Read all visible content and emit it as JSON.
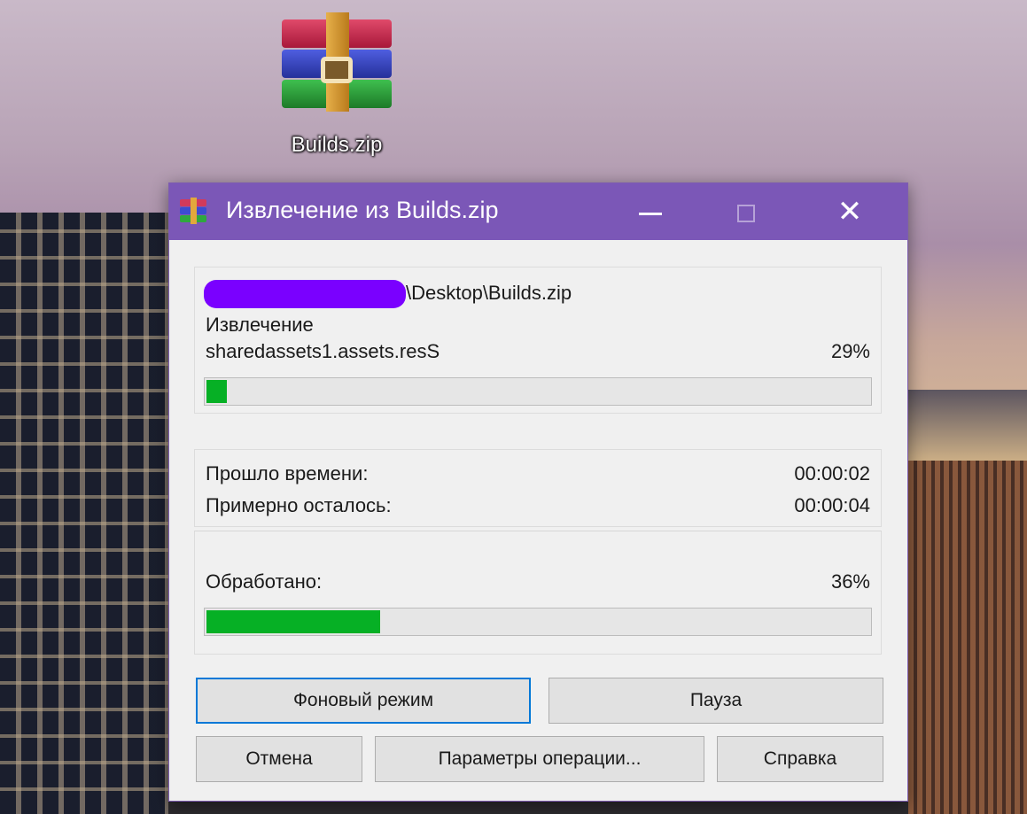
{
  "desktop": {
    "icon_label": "Builds.zip"
  },
  "dialog": {
    "title": "Извлечение из Builds.zip",
    "archive_path": "\\Desktop\\Builds.zip",
    "operation": "Извлечение",
    "current_file": "sharedassets1.assets.resS",
    "file_percent": "29%",
    "file_progress": 0.03,
    "elapsed_label": "Прошло времени:",
    "elapsed_value": "00:00:02",
    "remaining_label": "Примерно осталось:",
    "remaining_value": "00:00:04",
    "processed_label": "Обработано:",
    "processed_percent": "36%",
    "processed_progress": 0.26,
    "buttons": {
      "background": "Фоновый режим",
      "pause": "Пауза",
      "cancel": "Отмена",
      "params": "Параметры операции...",
      "help": "Справка"
    }
  },
  "colors": {
    "titlebar": "#7b57b7",
    "progress_fill": "#06b025",
    "redaction": "#7a00ff",
    "focus_border": "#0078d7"
  },
  "icons": [
    "winrar-archive-icon",
    "winrar-title-icon",
    "minimize-icon",
    "maximize-icon",
    "close-icon"
  ]
}
